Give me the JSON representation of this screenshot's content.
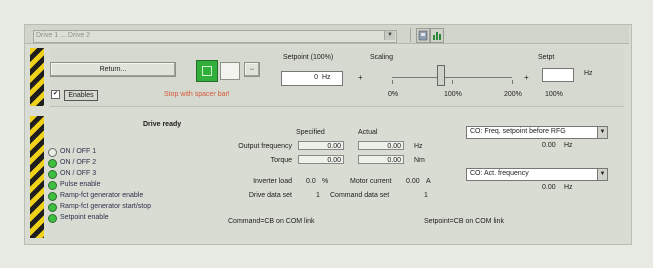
{
  "window": {
    "combo_text": "Drive 1 ... Drive 2",
    "dropdown_arrow": "▼",
    "toolbar_icons": [
      "settings-icon",
      "chart-icon"
    ]
  },
  "control": {
    "return_button": "Return...",
    "on_button_icon": "square-icon",
    "direction_button": "↔",
    "enables_label": "Enables",
    "enables_checked": "✔",
    "stop_text": "Stop with spacer bar!"
  },
  "setpoint": {
    "title": "Setpoint (100%)",
    "value": "0",
    "unit": "Hz",
    "operator_plus_1": "+",
    "operator_plus_2": "+"
  },
  "scaling": {
    "title": "Scaling",
    "tick_labels": [
      "0%",
      "100%",
      "200%"
    ],
    "position_percent": 100
  },
  "sspt": {
    "title": "Setpt",
    "unit": "Hz",
    "percent": "100%"
  },
  "drive": {
    "title": "Drive ready",
    "status_items": [
      {
        "label": "ON / OFF 1",
        "active": false
      },
      {
        "label": "ON / OFF 2",
        "active": true
      },
      {
        "label": "ON / OFF 3",
        "active": true
      },
      {
        "label": "Pulse enable",
        "active": true
      },
      {
        "label": "Ramp-fct generator enable",
        "active": true
      },
      {
        "label": "Ramp-fct generator start/stop",
        "active": true
      },
      {
        "label": "Setpoint enable",
        "active": true
      }
    ],
    "col_specified": "Specified",
    "col_actual": "Actual",
    "output_frequency_label": "Output frequency",
    "output_frequency_specified": "0.00",
    "output_frequency_actual": "0.00",
    "output_frequency_unit": "Hz",
    "torque_label": "Torque",
    "torque_specified": "0.00",
    "torque_actual": "0.00",
    "torque_unit": "Nm",
    "inverter_load_label": "Inverter load",
    "inverter_load_value": "0.0",
    "inverter_load_unit": "%",
    "motor_current_label": "Motor current",
    "motor_current_value": "0.00",
    "motor_current_unit": "A",
    "drive_data_set_label": "Drive data set",
    "drive_data_set_value": "1",
    "command_data_set_label": "Command data set",
    "command_data_set_value": "1",
    "command_source": "Command=CB on COM link",
    "setpoint_source": "Setpoint=CB on COM link"
  },
  "right_panels": {
    "dd1_text": "CO: Freq. setpoint before RFG",
    "dd1_value": "0.00",
    "dd1_unit": "Hz",
    "dd2_text": "CO: Act. frequency",
    "dd2_value": "0.00",
    "dd2_unit": "Hz"
  }
}
